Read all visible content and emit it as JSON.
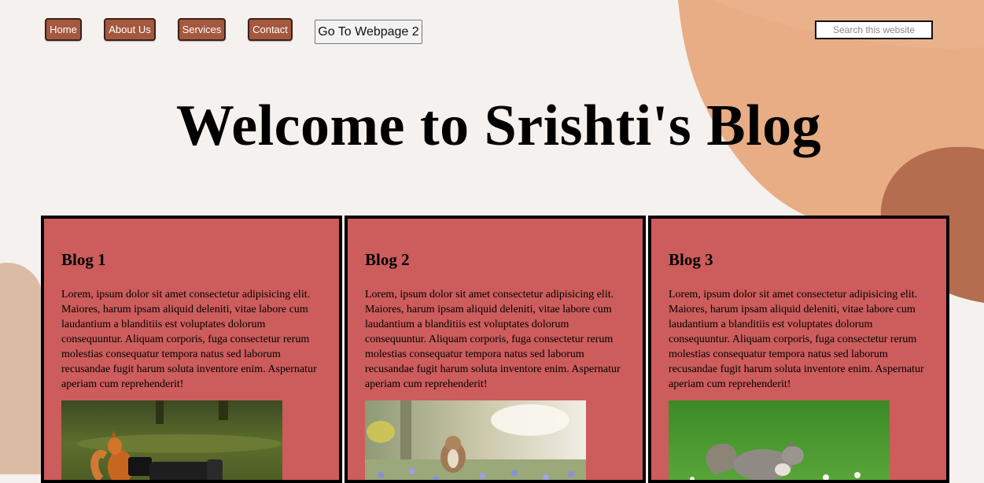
{
  "nav": {
    "items": [
      {
        "label": "Home"
      },
      {
        "label": "About Us"
      },
      {
        "label": "Services"
      },
      {
        "label": "Contact"
      }
    ],
    "page2_button": "Go To Webpage 2",
    "search_placeholder": "Search this website"
  },
  "header": {
    "title": "Welcome to Srishti's Blog"
  },
  "blogs": [
    {
      "title": "Blog 1",
      "text": "Lorem, ipsum dolor sit amet consectetur adipisicing elit. Maiores, harum ipsam aliquid deleniti, vitae labore cum laudantium a blanditiis est voluptates dolorum consequuntur. Aliquam corporis, fuga consectetur rerum molestias consequatur tempora natus sed laborum recusandae fugit harum soluta inventore enim. Aspernatur aperiam cum reprehenderit!",
      "image": "squirrel-with-camera-photo"
    },
    {
      "title": "Blog 2",
      "text": "Lorem, ipsum dolor sit amet consectetur adipisicing elit. Maiores, harum ipsam aliquid deleniti, vitae labore cum laudantium a blanditiis est voluptates dolorum consequuntur. Aliquam corporis, fuga consectetur rerum molestias consequatur tempora natus sed laborum recusandae fugit harum soluta inventore enim. Aspernatur aperiam cum reprehenderit!",
      "image": "chipmunk-in-flowers-photo"
    },
    {
      "title": "Blog 3",
      "text": "Lorem, ipsum dolor sit amet consectetur adipisicing elit. Maiores, harum ipsam aliquid deleniti, vitae labore cum laudantium a blanditiis est voluptates dolorum consequuntur. Aliquam corporis, fuga consectetur rerum molestias consequatur tempora natus sed laborum recusandae fugit harum soluta inventore enim. Aspernatur aperiam cum reprehenderit!",
      "image": "grey-squirrel-on-grass-photo"
    }
  ],
  "colors": {
    "background": "#f5f1ef",
    "nav_button": "#a4583f",
    "card": "#cd5c5c",
    "blob_light": "#e8ad84",
    "blob_dark": "#b56d4f",
    "blob_left": "#dcbba5"
  }
}
